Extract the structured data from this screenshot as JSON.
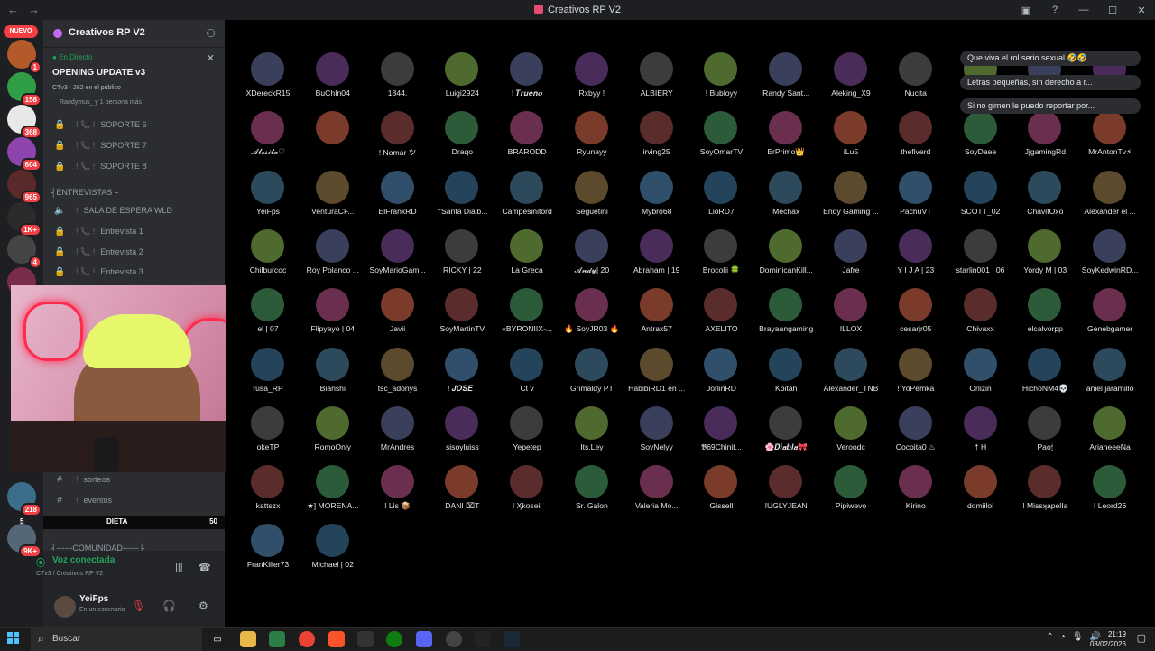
{
  "window": {
    "title": "Creativos RP V2"
  },
  "rail": {
    "nuevo": "NUEVO",
    "servers": [
      {
        "badge": "1",
        "color": "#b45a2a"
      },
      {
        "badge": "158",
        "color": "#2f9e44"
      },
      {
        "badge": "368",
        "color": "#e8e8e8"
      },
      {
        "badge": "604",
        "color": "#8e44ad"
      },
      {
        "badge": "965",
        "color": "#5a2a2a"
      },
      {
        "badge": "1K+",
        "color": "#2b2b2b"
      },
      {
        "badge": "4",
        "color": "#444444"
      },
      {
        "badge": "983",
        "color": "#7a2d4a"
      },
      {
        "badge": "218",
        "color": "#3c6e8c"
      },
      {
        "badge": "9K+",
        "color": "#556677"
      }
    ]
  },
  "sidebar": {
    "server_name": "Creativos RP V2",
    "live": {
      "tag": "En Directo",
      "title": "OPENING UPDATE v3",
      "meta": "CTv3  ·  282 en el público",
      "meta2": "Randymus_ y 1 persona más"
    },
    "channels_top": [
      {
        "label": "SOPORTE 6"
      },
      {
        "label": "SOPORTE 7"
      },
      {
        "label": "SOPORTE 8"
      }
    ],
    "category_entrevistas": "┤ENTREVISTAS├",
    "channels_mid": [
      {
        "label": "SALA DE ESPERA WLD"
      },
      {
        "label": "Entrevista 1"
      },
      {
        "label": "Entrevista 2"
      },
      {
        "label": "Entrevista 3"
      }
    ],
    "channels_bottom": [
      {
        "label": "sorteos"
      },
      {
        "label": "eventos"
      }
    ],
    "diet_bar": {
      "left": "5",
      "label": "DIETA",
      "value": "50"
    },
    "category_comunidad": "┤------COMUNIDAD------├"
  },
  "voice": {
    "status": "Voz conectada",
    "channel": "CTv3 / Creativos RP V2"
  },
  "user": {
    "name": "YeiFps",
    "status": "En un escenario"
  },
  "grid": {
    "rows": [
      [
        "XDereckR15",
        "BuChIn04",
        "1844.",
        "Luigi2924",
        "! 𝑻𝒓𝒖𝒆𝒏𝒐",
        "Rxbyy !",
        "ALBIERY",
        "! Bubloyy",
        "Randy Sant...",
        "Aleking_X9",
        "Nucita",
        "",
        "",
        ""
      ],
      [
        "𝓐𝓵𝓮𝓼𝓲𝓽𝓪♡",
        "",
        "! Nomar ツ",
        "Draqo",
        "BRARODD",
        "Ryunayy",
        "irving25",
        "SoyOmarTV",
        "ErPrimo👑",
        "iLu5",
        "thefiverd",
        "SoyDaee",
        "JjgamingRd",
        "MrAntonTv⚡"
      ],
      [
        "YeiFps",
        "VenturaCF...",
        "ElFrankRD",
        "†Santa Dia'b...",
        "Campesinitord",
        "Seguetini",
        "Mybro68",
        "LioRD7",
        "Mechax",
        "Endy Gaming ...",
        "PachuVT",
        "SCOTT_02",
        "ChavitOxo",
        "Alexander el ..."
      ],
      [
        "Chilburcoc",
        "Roy Polanco ...",
        "SoyMarioGam...",
        "RICKY | 22",
        "La Greca",
        "𝓐𝓷𝓭𝔂| 20",
        "Abraham | 19",
        "Brocolii 🍀",
        "DominicanKill...",
        "Jafre",
        "Y I J A | 23",
        "starlin001 | 06",
        "Yordy M | 03",
        "SoyKedwinRD..."
      ],
      [
        "el | 07",
        "Flipyayo | 04",
        "Javii",
        "SoyMartinTV",
        "«BYRONIIX-...",
        "🔥 SoyJR03 🔥",
        "Antrax57",
        "AXELITO",
        "Brayaangaming",
        "ILLOX",
        "cesarjr05",
        "Chivaxx",
        "elcalvorpp",
        "Genebgamer"
      ],
      [
        "rusa_RP",
        "Bianshi",
        "tsc_adonys",
        "! 𝑱𝑶𝑺𝑬 !",
        "Ct v",
        "Grimaldy PT",
        "HabibiRD1 en ...",
        "JorlinRD",
        "Kbitah",
        "Alexander_TNB",
        "! YoPemka",
        "Orlizin",
        "HichoNM4💀",
        "aniel jaramillo"
      ],
      [
        "okeTP",
        "RomoOnly",
        "MrAndres",
        "sisoyluiss",
        "Yepetep",
        "Its.Ley",
        "SoyNelyy",
        "𝕭69Chinit...",
        "🌸𝑫𝒊𝒂𝒃𝒍𝒂🎀",
        "Veroodc",
        "Cocoita0 ♨",
        "† H",
        "Pao🕯",
        "ArianeeeNa"
      ],
      [
        "kattszx",
        "★] MORENA...",
        "! Lis 📦",
        "DANI ⌧T",
        "! Ӽkoseii",
        "Sr. Galon",
        "Valeria Mo...",
        "Gissell",
        "!UGLYJEAN",
        "Pipiwevo",
        "Kirino",
        "domiilol",
        "! MissʞapelIa",
        "! Leord26"
      ],
      [
        "FranKiller73",
        "Michael | 02"
      ]
    ]
  },
  "chat_bubbles": [
    "Que viva el rol serio sexual 🤣🤣",
    "Letras pequeñas, sin derecho a r...",
    "Si no gimen le puedo reportar por..."
  ],
  "taskbar": {
    "search_placeholder": "Buscar",
    "time": "21:19",
    "date": "03/02/2026"
  }
}
